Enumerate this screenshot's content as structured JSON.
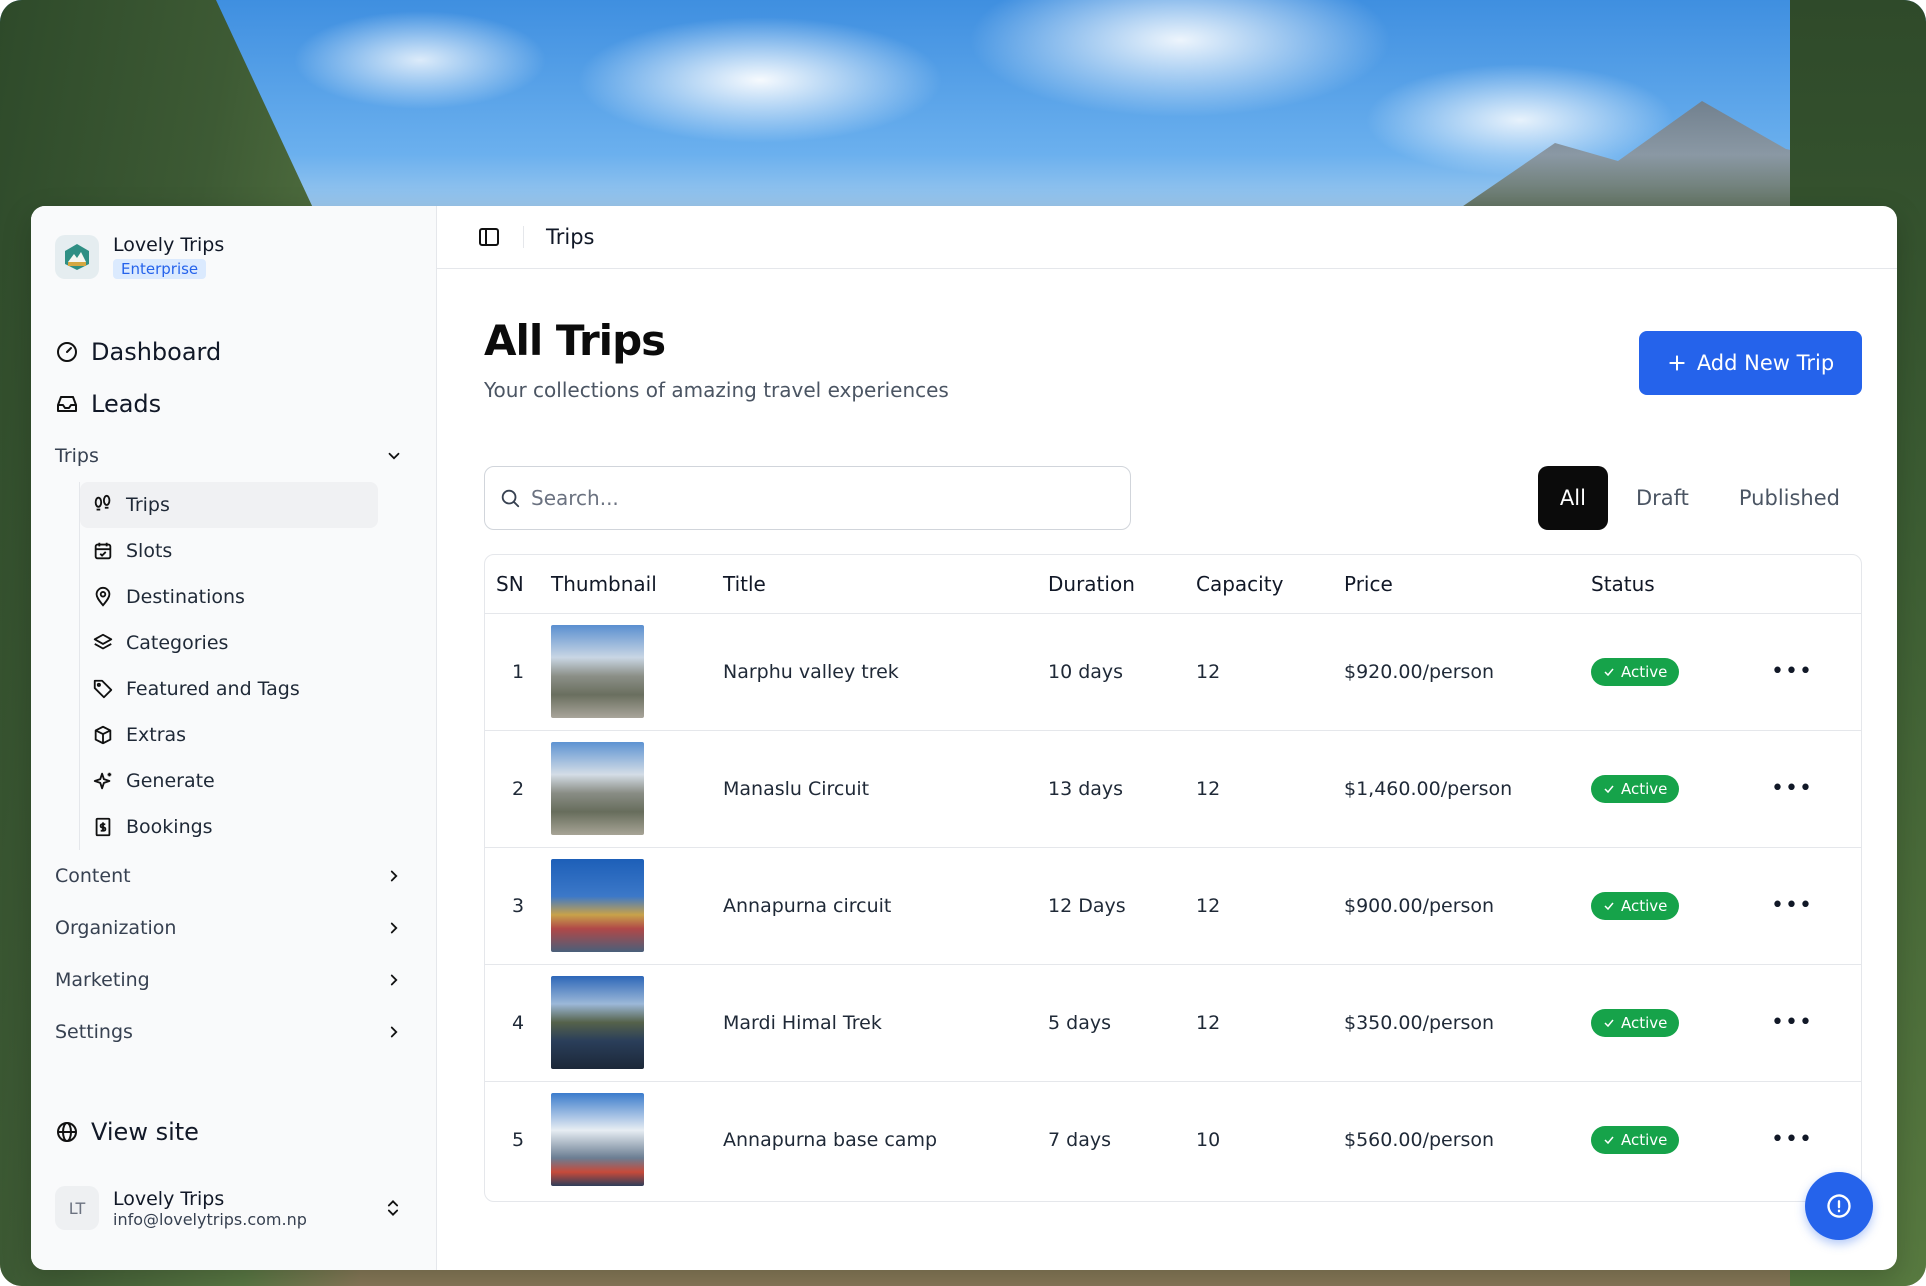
{
  "brand": {
    "name": "Lovely Trips",
    "badge": "Enterprise",
    "logo_icon": "mountain-logo-icon"
  },
  "nav": {
    "dashboard": "Dashboard",
    "leads": "Leads",
    "trips_group": "Trips",
    "trips_sub": [
      {
        "label": "Trips",
        "icon": "footprints-icon"
      },
      {
        "label": "Slots",
        "icon": "calendar-icon"
      },
      {
        "label": "Destinations",
        "icon": "map-pin-icon"
      },
      {
        "label": "Categories",
        "icon": "layers-icon"
      },
      {
        "label": "Featured and Tags",
        "icon": "tag-icon"
      },
      {
        "label": "Extras",
        "icon": "package-icon"
      },
      {
        "label": "Generate",
        "icon": "sparkles-icon"
      },
      {
        "label": "Bookings",
        "icon": "receipt-icon"
      }
    ],
    "content": "Content",
    "organization": "Organization",
    "marketing": "Marketing",
    "settings": "Settings",
    "view_site": "View site"
  },
  "user": {
    "initials": "LT",
    "name": "Lovely Trips",
    "email": "info@lovelytrips.com.np"
  },
  "topbar": {
    "crumb": "Trips"
  },
  "page": {
    "title": "All Trips",
    "subtitle": "Your collections of amazing travel experiences",
    "add_button": "Add New Trip"
  },
  "search": {
    "placeholder": "Search..."
  },
  "filters": {
    "all": "All",
    "draft": "Draft",
    "published": "Published"
  },
  "table": {
    "headers": {
      "sn": "SN",
      "thumbnail": "Thumbnail",
      "title": "Title",
      "duration": "Duration",
      "capacity": "Capacity",
      "price": "Price",
      "status": "Status"
    },
    "rows": [
      {
        "sn": "1",
        "title": "Narphu valley trek",
        "duration": "10 days",
        "capacity": "12",
        "price": "$920.00/person",
        "status": "Active"
      },
      {
        "sn": "2",
        "title": "Manaslu Circuit",
        "duration": "13 days",
        "capacity": "12",
        "price": "$1,460.00/person",
        "status": "Active"
      },
      {
        "sn": "3",
        "title": "Annapurna circuit",
        "duration": "12 Days",
        "capacity": "12",
        "price": "$900.00/person",
        "status": "Active"
      },
      {
        "sn": "4",
        "title": "Mardi Himal Trek",
        "duration": "5 days",
        "capacity": "12",
        "price": "$350.00/person",
        "status": "Active"
      },
      {
        "sn": "5",
        "title": "Annapurna base camp",
        "duration": "7 days",
        "capacity": "10",
        "price": "$560.00/person",
        "status": "Active"
      }
    ]
  },
  "colors": {
    "accent": "#2563eb",
    "active_status": "#16a34a",
    "filter_active": "#0b0b0b"
  }
}
